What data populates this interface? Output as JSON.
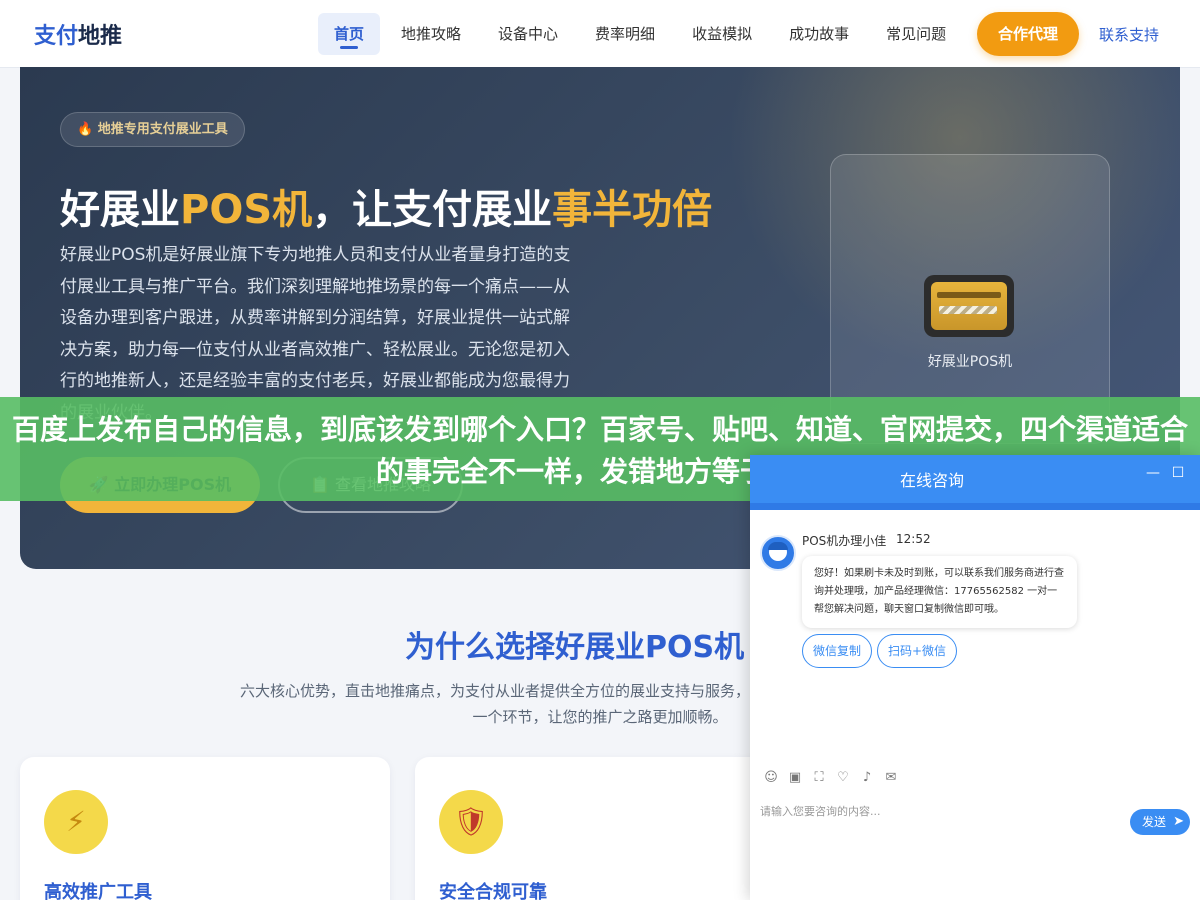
{
  "nav": {
    "logo_part1": "支付",
    "logo_part2": "地推",
    "items": [
      {
        "label": "首页",
        "active": true
      },
      {
        "label": "地推攻略"
      },
      {
        "label": "设备中心"
      },
      {
        "label": "费率明细"
      },
      {
        "label": "收益模拟"
      },
      {
        "label": "成功故事"
      },
      {
        "label": "常见问题"
      }
    ],
    "cta_label": "合作代理",
    "contact_label": "联系支持",
    "accent": "#2f5fd0",
    "cta_color": "#f29b11"
  },
  "hero": {
    "tag": "🔥 地推专用支付展业工具",
    "title_a": "好展业",
    "title_b": "POS机",
    "title_c": "，让支付展业",
    "title_d": "事半功倍",
    "description": "好展业POS机是好展业旗下专为地推人员和支付从业者量身打造的支付展业工具与推广平台。我们深刻理解地推场景的每一个痛点——从设备办理到客户跟进，从费率讲解到分润结算，好展业提供一站式解决方案，助力每一位支付从业者高效推广、轻松展业。无论您是初入行的地推新人，还是经验丰富的支付老兵，好展业都能成为您最得力的展业伙伴。",
    "apply_button": "🚀 立即办理POS机",
    "guide_button": "📋 查看地推攻略",
    "card_label": "好展业POS机",
    "card_icon": "credit-card-icon",
    "highlight_color": "#f2b53a"
  },
  "why": {
    "title": "为什么选择好展业POS机",
    "description": "六大核心优势，直击地推痛点，为支付从业者提供全方位的展业支持与服务，从培训到收益，我们用心打磨每一个环节，让您的推广之路更加顺畅。",
    "features": [
      {
        "title": "高效推广工具",
        "icon": "lightning-icon",
        "glyph": "⚡"
      },
      {
        "title": "安全合规可靠",
        "icon": "shield-icon",
        "glyph": "🛡"
      }
    ]
  },
  "banner": {
    "text": "百度上发布自己的信息，到底该发到哪个入口？百家号、贴吧、知道、官网提交，四个渠道适合的事完全不一样，发错地方等于白发"
  },
  "chat": {
    "title": "在线咨询",
    "minimize_glyph": "—",
    "maximize_glyph": "☐",
    "sender": "POS机办理小佳",
    "time": "12:52",
    "message": "您好！如果刷卡未及时到账，可以联系我们服务商进行查询并处理哦，加产品经理微信：17765562582 一对一帮您解决问题，聊天窗口复制微信即可哦。",
    "quick_replies": [
      "微信复制",
      "扫码+微信"
    ],
    "tools": [
      "☺",
      "▣",
      "⛶",
      "♡",
      "♪",
      "✉"
    ],
    "input_placeholder": "请输入您要咨询的内容...",
    "send_label": "发送",
    "send_glyph": "➤",
    "header_color": "#3a8df3"
  }
}
